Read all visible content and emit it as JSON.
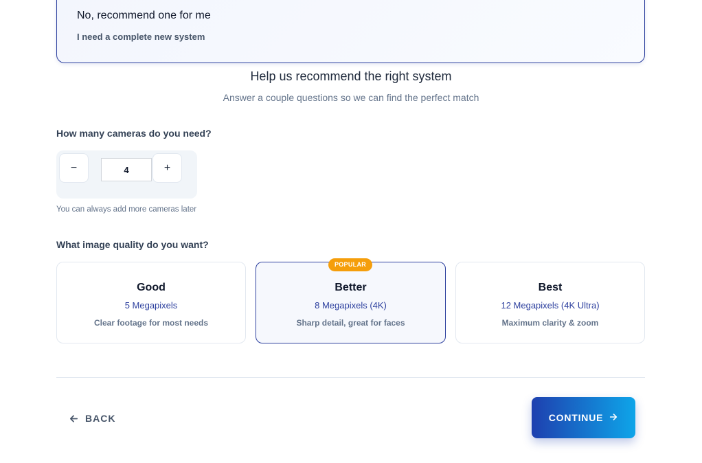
{
  "top_option": {
    "title": "No, recommend one for me",
    "subtitle": "I need a complete new system"
  },
  "section": {
    "title": "Help us recommend the right system",
    "subtitle": "Answer a couple questions so we can find the perfect match"
  },
  "cameras": {
    "question": "How many cameras do you need?",
    "minus_label": "−",
    "plus_label": "+",
    "value": "4",
    "hint": "You can always add more cameras later"
  },
  "quality": {
    "question": "What image quality do you want?",
    "badge": "POPULAR",
    "options": [
      {
        "name": "Good",
        "megapixels": "5 Megapixels",
        "description": "Clear footage for most needs"
      },
      {
        "name": "Better",
        "megapixels": "8 Megapixels (4K)",
        "description": "Sharp detail, great for faces"
      },
      {
        "name": "Best",
        "megapixels": "12 Megapixels (4K Ultra)",
        "description": "Maximum clarity & zoom"
      }
    ],
    "selected": "Better"
  },
  "nav": {
    "back_label": "BACK",
    "continue_label": "CONTINUE",
    "back_icon": "arrow-left-icon",
    "continue_icon": "arrow-right-icon"
  },
  "colors": {
    "accent": "#2c3f9e",
    "badge": "#f59e0b",
    "continue_start": "#1e40af",
    "continue_end": "#0ea5e9"
  }
}
